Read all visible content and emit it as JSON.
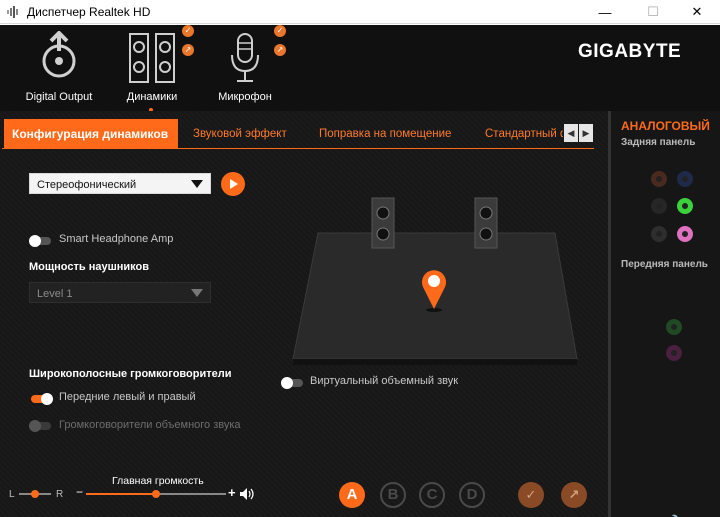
{
  "window": {
    "title": "Диспетчер Realtek HD",
    "min_label": "—",
    "max_label": "☐",
    "close_label": "✕"
  },
  "header": {
    "brand": "GIGABYTE",
    "devices": [
      {
        "label": "Digital Output",
        "icon": "digital-output-icon"
      },
      {
        "label": "Динамики",
        "icon": "speakers-icon",
        "active": true
      },
      {
        "label": "Микрофон",
        "icon": "microphone-icon"
      }
    ]
  },
  "tabs": [
    {
      "label": "Конфигурация динамиков",
      "active": true
    },
    {
      "label": "Звуковой эффект"
    },
    {
      "label": "Поправка на помещение"
    },
    {
      "label": "Стандартный фо"
    }
  ],
  "config": {
    "speaker_config_value": "Стереофонический",
    "smart_headphone_label": "Smart Headphone Amp",
    "smart_headphone_on": false,
    "headphone_power_title": "Мощность наушников",
    "headphone_power_value": "Level 1",
    "fullrange_title": "Широкополосные громкоговорители",
    "front_lr_label": "Передние левый и правый",
    "front_lr_on": true,
    "surround_label": "Громкоговорители объемного звука",
    "surround_enabled": false,
    "virtual_surround_label": "Виртуальный объемный звук",
    "virtual_surround_on": false
  },
  "volume": {
    "title": "Главная громкость",
    "left_label": "L",
    "right_label": "R",
    "minus": "−",
    "plus": "+",
    "balance": 0.5,
    "level": 0.5
  },
  "modes": [
    {
      "label": "A",
      "active": true
    },
    {
      "label": "B",
      "active": false
    },
    {
      "label": "C",
      "active": false
    },
    {
      "label": "D",
      "active": false
    }
  ],
  "right_panel": {
    "title": "АНАЛОГОВЫЙ",
    "rear_label": "Задняя панель",
    "front_label": "Передняя панель"
  },
  "colors": {
    "accent": "#ff6a1a",
    "background": "#171717",
    "jack_green": "#3ad13a",
    "jack_pink": "#e070c0"
  }
}
